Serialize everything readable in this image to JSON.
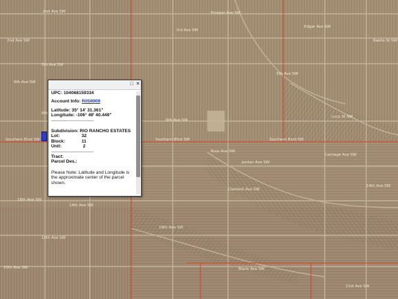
{
  "map": {
    "street_labels": [
      {
        "text": "2nd Ave SW"
      },
      {
        "text": "2nd Ave SW"
      },
      {
        "text": "Prosper Ave SW"
      },
      {
        "text": "Edgar Ave SW"
      },
      {
        "text": "3rd Ave SW"
      },
      {
        "text": "5th Ave SW"
      },
      {
        "text": "5th Ave SW"
      },
      {
        "text": "Raelia St SW"
      },
      {
        "text": "6th Ave SW"
      },
      {
        "text": "6th Ave SW"
      },
      {
        "text": "8th Ave SW"
      },
      {
        "text": "Lucy St SW"
      },
      {
        "text": "Southern Blvd SW"
      },
      {
        "text": "Southern Blvd SW"
      },
      {
        "text": "Southern Blvd SW"
      },
      {
        "text": "Ross Ave SW"
      },
      {
        "text": "Jordan Ave SW"
      },
      {
        "text": "Carriage Ave SW"
      },
      {
        "text": "Clement Ave SW"
      },
      {
        "text": "14th Ave SW"
      },
      {
        "text": "16th Ave SW"
      },
      {
        "text": "14th Ave SW"
      },
      {
        "text": "16th Ave SW"
      },
      {
        "text": "19th Ave SW"
      },
      {
        "text": "20th Ave SW"
      },
      {
        "text": "Blank Ave SW"
      },
      {
        "text": "21st Ave SW"
      }
    ]
  },
  "popup": {
    "upc_label": "UPC:",
    "upc_value": "104068159334",
    "account_label": "Account Info:",
    "account_value": "R058909",
    "latitude_label": "Latitude:",
    "latitude_value": "35° 14' 31.361\"",
    "longitude_label": "Longitude:",
    "longitude_value": "-106° 49' 40.449\"",
    "separator": "------------------------------------",
    "subdivision_label": "Subdivision:",
    "subdivision_value": "RIO RANCHO ESTATES",
    "lot_label": "Lot:",
    "lot_value": "32",
    "block_label": "Block:",
    "block_value": "11",
    "unit_label": "Unit:",
    "unit_value": "2",
    "tract_label": "Tract:",
    "parcel_label": "Parcel Des.:",
    "note": "Please Note: Latitude and Longitude is the approximate center of the parcel shown."
  }
}
